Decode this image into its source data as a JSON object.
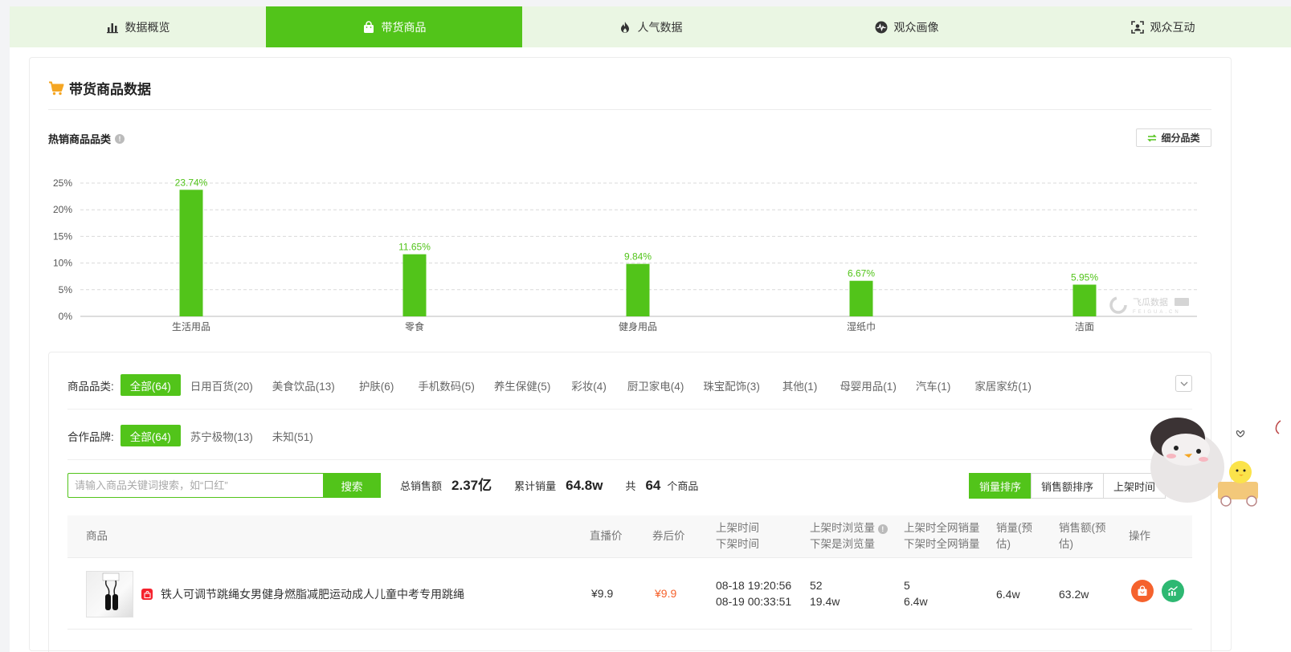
{
  "tabs": [
    {
      "label": "数据概览",
      "icon": "bar-chart-icon",
      "active": false
    },
    {
      "label": "带货商品",
      "icon": "shopping-bag-icon",
      "active": true
    },
    {
      "label": "人气数据",
      "icon": "flame-icon",
      "active": false
    },
    {
      "label": "观众画像",
      "icon": "pulse-icon",
      "active": false
    },
    {
      "label": "观众互动",
      "icon": "user-frame-icon",
      "active": false
    }
  ],
  "section": {
    "title": "带货商品数据",
    "icon": "cart-icon"
  },
  "hot_category": {
    "title": "热销商品品类",
    "info_icon": "info-icon",
    "detail_button": "细分品类"
  },
  "chart_data": {
    "type": "bar",
    "categories": [
      "生活用品",
      "零食",
      "健身用品",
      "湿纸巾",
      "洁面"
    ],
    "values": [
      23.74,
      11.65,
      9.84,
      6.67,
      5.95
    ],
    "value_labels": [
      "23.74%",
      "11.65%",
      "9.84%",
      "6.67%",
      "5.95%"
    ],
    "yticks": [
      "0%",
      "5%",
      "10%",
      "15%",
      "20%",
      "25%"
    ],
    "ylim": [
      0,
      25
    ],
    "grid": true,
    "color": "#52c41a",
    "watermark": "飞瓜数据"
  },
  "filters": {
    "category_label": "商品品类:",
    "categories": [
      "全部(64)",
      "日用百货(20)",
      "美食饮品(13)",
      "护肤(6)",
      "手机数码(5)",
      "养生保健(5)",
      "彩妆(4)",
      "厨卫家电(4)",
      "珠宝配饰(3)",
      "其他(1)",
      "母婴用品(1)",
      "汽车(1)",
      "家居家纺(1)"
    ],
    "brand_label": "合作品牌:",
    "brands": [
      "全部(64)",
      "苏宁极物(13)",
      "未知(51)"
    ]
  },
  "search": {
    "placeholder": "请输入商品关键词搜索，如“口红”",
    "button": "搜索"
  },
  "stats": {
    "total_sales_label": "总销售额",
    "total_sales": "2.37亿",
    "total_volume_label": "累计销量",
    "total_volume": "64.8w",
    "count_prefix": "共",
    "count": "64",
    "count_suffix": "个商品"
  },
  "sort": {
    "volume": "销量排序",
    "amount": "销售额排序",
    "shelf": "上架时间"
  },
  "table": {
    "headers": {
      "product": "商品",
      "live_price": "直播价",
      "coupon_price": "券后价",
      "on_time": "上架时间",
      "off_time": "下架时间",
      "on_views": "上架时浏览量",
      "off_views": "下架是浏览量",
      "on_sales": "上架时全网销量",
      "off_sales": "下架时全网销量",
      "volume": "销量(预估)",
      "amount": "销售额(预估)",
      "ops": "操作"
    },
    "rows": [
      {
        "title": "铁人可调节跳绳女男健身燃脂减肥运动成人儿童中考专用跳绳",
        "live_price": "¥9.9",
        "coupon_price": "¥9.9",
        "on_time": "08-18 19:20:56",
        "off_time": "08-19 00:33:51",
        "on_views": "52",
        "off_views": "19.4w",
        "on_sales": "5",
        "off_sales": "6.4w",
        "volume": "6.4w",
        "amount": "63.2w"
      }
    ]
  }
}
